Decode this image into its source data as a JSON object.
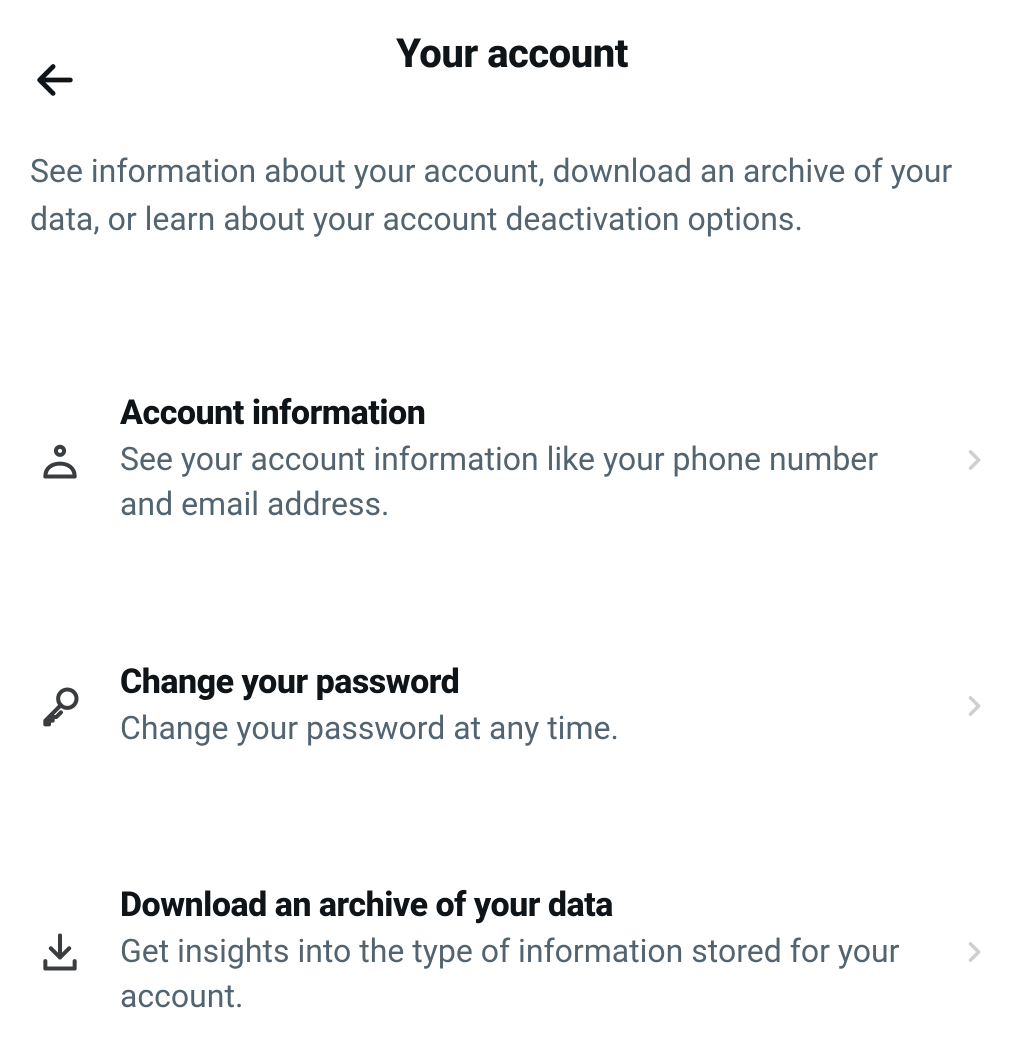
{
  "header": {
    "title": "Your account"
  },
  "description": "See information about your account, download an archive of your data, or learn about your account deactivation options.",
  "menu": [
    {
      "title": "Account information",
      "subtitle": "See your account information like your phone number and email address."
    },
    {
      "title": "Change your password",
      "subtitle": "Change your password at any time."
    },
    {
      "title": "Download an archive of your data",
      "subtitle": "Get insights into the type of information stored for your account."
    }
  ]
}
